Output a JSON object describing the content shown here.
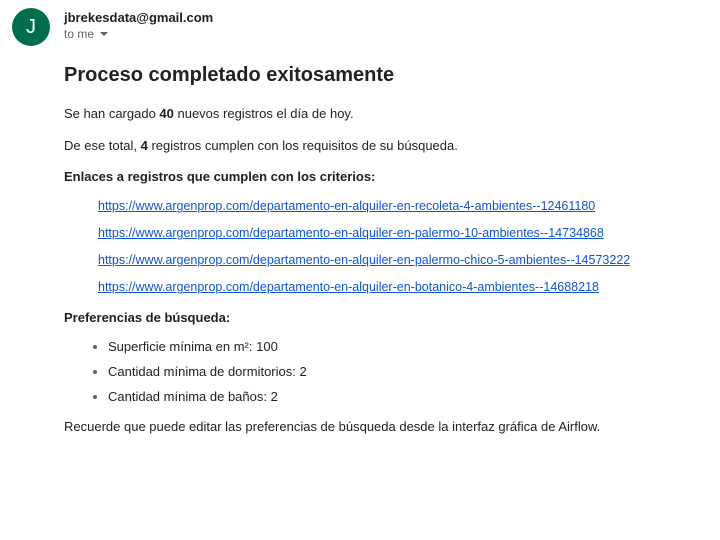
{
  "sender": {
    "avatar_initial": "J",
    "email": "jbrekesdata@gmail.com",
    "recipient_label": "to me"
  },
  "body": {
    "title": "Proceso completado exitosamente",
    "line1_a": "Se han cargado ",
    "line1_b": "40",
    "line1_c": " nuevos registros el día de hoy.",
    "line2_a": "De ese total, ",
    "line2_b": "4",
    "line2_c": " registros cumplen con los requisitos de su búsqueda.",
    "links_heading": "Enlaces a registros que cumplen con los criterios:",
    "links": [
      "https://www.argenprop.com/departamento-en-alquiler-en-recoleta-4-ambientes--12461180",
      "https://www.argenprop.com/departamento-en-alquiler-en-palermo-10-ambientes--14734868",
      "https://www.argenprop.com/departamento-en-alquiler-en-palermo-chico-5-ambientes--14573222",
      "https://www.argenprop.com/departamento-en-alquiler-en-botanico-4-ambientes--14688218"
    ],
    "prefs_heading": "Preferencias de búsqueda:",
    "prefs": [
      "Superficie mínima en m²: 100",
      "Cantidad mínima de dormitorios: 2",
      "Cantidad mínima de baños: 2"
    ],
    "footer": "Recuerde que puede editar las preferencias de búsqueda desde la interfaz gráfica de Airflow."
  }
}
